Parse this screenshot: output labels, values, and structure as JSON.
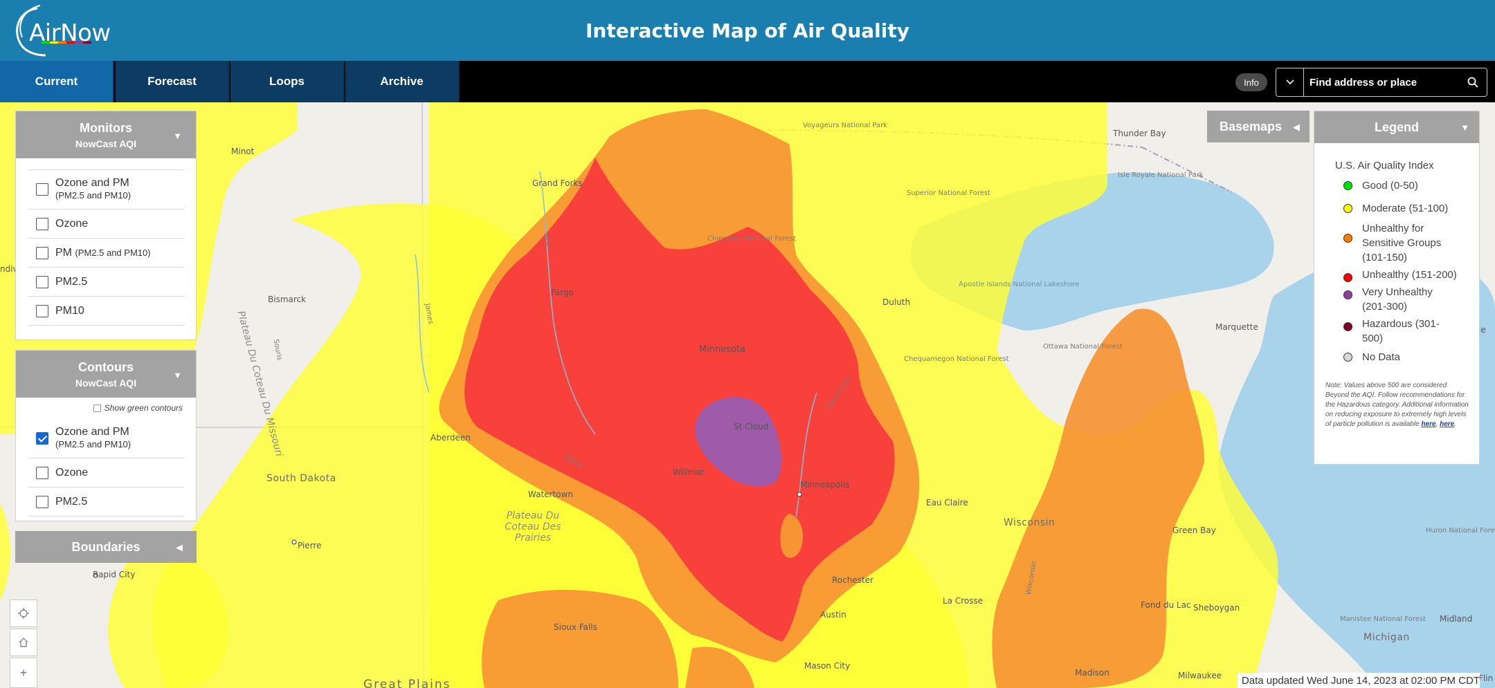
{
  "header": {
    "logo_text": "AirNow",
    "title": "Interactive Map of Air Quality"
  },
  "nav": {
    "tabs": [
      {
        "label": "Current",
        "active": true
      },
      {
        "label": "Forecast",
        "active": false
      },
      {
        "label": "Loops",
        "active": false
      },
      {
        "label": "Archive",
        "active": false
      }
    ],
    "info_label": "Info",
    "search": {
      "placeholder": "Find address or place",
      "value": ""
    }
  },
  "monitors_panel": {
    "title": "Monitors",
    "subtitle": "NowCast AQI",
    "options": [
      {
        "label": "Ozone and PM",
        "sub": "(PM2.5 and PM10)",
        "checked": false
      },
      {
        "label": "Ozone",
        "sub": "",
        "checked": false
      },
      {
        "label": "PM",
        "sub": "(PM2.5 and PM10)",
        "checked": false
      },
      {
        "label": "PM2.5",
        "sub": "",
        "checked": false
      },
      {
        "label": "PM10",
        "sub": "",
        "checked": false
      }
    ]
  },
  "contours_panel": {
    "title": "Contours",
    "subtitle": "NowCast AQI",
    "show_green_label": "Show green contours",
    "options": [
      {
        "label": "Ozone and PM",
        "sub": "(PM2.5 and PM10)",
        "checked": true
      },
      {
        "label": "Ozone",
        "sub": "",
        "checked": false
      },
      {
        "label": "PM2.5",
        "sub": "",
        "checked": false
      }
    ]
  },
  "boundaries_label": "Boundaries",
  "basemaps_label": "Basemaps",
  "legend": {
    "title": "Legend",
    "subtitle": "U.S. Air Quality Index",
    "items": [
      {
        "label": "Good (0-50)",
        "color": "#00e400"
      },
      {
        "label": "Moderate (51-100)",
        "color": "#ffff00"
      },
      {
        "label": "Unhealthy for Sensitive Groups (101-150)",
        "color": "#ff7e00"
      },
      {
        "label": "Unhealthy (151-200)",
        "color": "#ff0000"
      },
      {
        "label": "Very Unhealthy (201-300)",
        "color": "#8f3f97"
      },
      {
        "label": "Hazardous (301-500)",
        "color": "#7e0023"
      },
      {
        "label": "No Data",
        "color": "#d7d7d7"
      }
    ],
    "note": "Note: Values above 500 are considered Beyond the AQI. Follow recommendations for the Hazardous category. Additional information on reducing exposure to extremely high levels of particle pollution is available",
    "link1": "here",
    "link2": "here"
  },
  "map_labels": {
    "minot": "Minot",
    "grand_forks": "Grand Forks",
    "fargo": "Fargo",
    "bismarck": "Bismarck",
    "voyageurs": "Voyageurs National Park",
    "thunder_bay": "Thunder Bay",
    "isle_royale": "Isle Royale National Park",
    "superior": "Superior National Forest",
    "chippewa": "Chippewa National Forest",
    "duluth": "Duluth",
    "apostle": "Apostle Islands National Lakeshore",
    "marquette": "Marquette",
    "minnesota": "Minnesota",
    "chequamegon": "Chequamegon National Forest",
    "ottawa": "Ottawa National Forest",
    "st_cloud": "St Cloud",
    "aberdeen": "Aberdeen",
    "willmar": "Willmar",
    "minneapolis": "Minneapolis",
    "south_dakota": "South Dakota",
    "watertown": "Watertown",
    "eau_claire": "Eau Claire",
    "wisconsin": "Wisconsin",
    "green_bay": "Green Bay",
    "huron": "Huron National Forest",
    "pierre": "Pierre",
    "rapid_city": "Rapid City",
    "rochester": "Rochester",
    "la_crosse": "La Crosse",
    "fond_du_lac": "Fond du Lac",
    "sheboygan": "Sheboygan",
    "manistee": "Manistee National Forest",
    "michigan": "Michigan",
    "midland": "Midland",
    "sioux_falls": "Sioux Falls",
    "austin": "Austin",
    "mason_city": "Mason City",
    "madison": "Madison",
    "milwaukee": "Milwaukee",
    "great_plains": "Great Plains",
    "plateau_missouri": "Plateau Du Coteau Du Missouri",
    "plateau_prairies": "Plateau Du Coteau Des Prairies",
    "james": "James",
    "saint_croix": "Saint Croix",
    "red": "Red",
    "sioux": "Sioux",
    "wisconsin_river": "Wisconsin",
    "souris": "Souris",
    "ndiv": "ndiv",
    "mi_edge": "le",
    "flin": "Flin"
  },
  "status": {
    "updated": "Data updated Wed June 14, 2023 at 02:00 PM CDT"
  },
  "colors": {
    "header": "#1a7faf",
    "nav_active": "#1167a8",
    "nav_tab": "#0c3c63",
    "aqi_moderate": "#ffff33",
    "aqi_usg": "#f79433",
    "aqi_unhealthy": "#f83c3c",
    "aqi_very_unhealthy": "#9b5cb0",
    "water": "#a9d3eb",
    "land": "#f1efe9"
  }
}
